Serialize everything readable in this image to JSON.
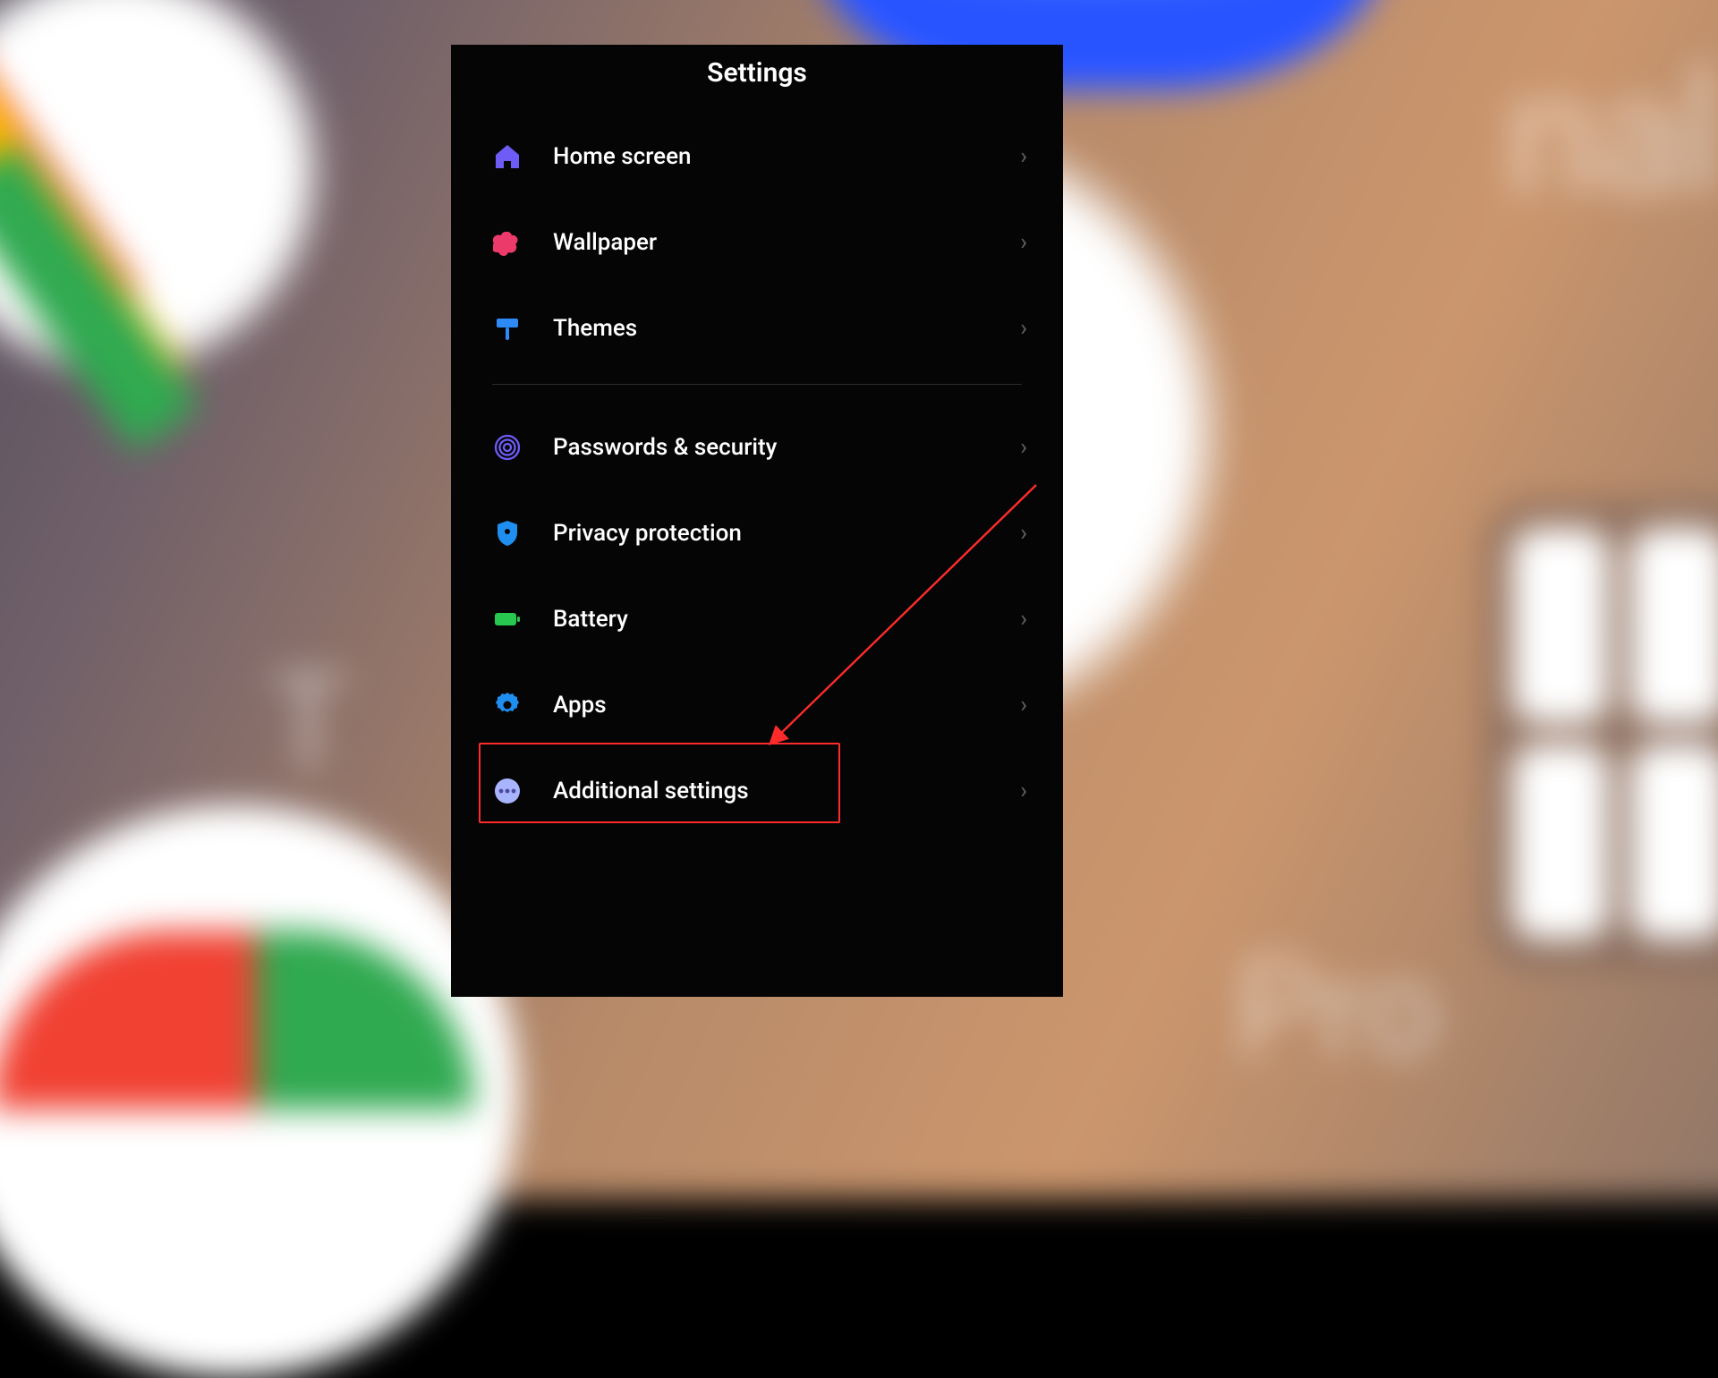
{
  "panel": {
    "title": "Settings"
  },
  "group1": {
    "home": {
      "label": "Home screen",
      "icon_color": "#6d5cf6"
    },
    "wallpaper": {
      "label": "Wallpaper",
      "icon_color": "#ec3a6b"
    },
    "themes": {
      "label": "Themes",
      "icon_color": "#2e8af7"
    }
  },
  "group2": {
    "passwords": {
      "label": "Passwords & security",
      "icon_color": "#6d5cf6"
    },
    "privacy": {
      "label": "Privacy protection",
      "icon_color": "#1f8ef1"
    },
    "battery": {
      "label": "Battery",
      "icon_color": "#28c850"
    },
    "apps": {
      "label": "Apps",
      "icon_color": "#1f8ef1"
    },
    "additional": {
      "label": "Additional settings",
      "icon_color": "#a9b4ff"
    }
  },
  "highlight": {
    "target": "apps"
  },
  "arrow_color": "#ff2b2b"
}
